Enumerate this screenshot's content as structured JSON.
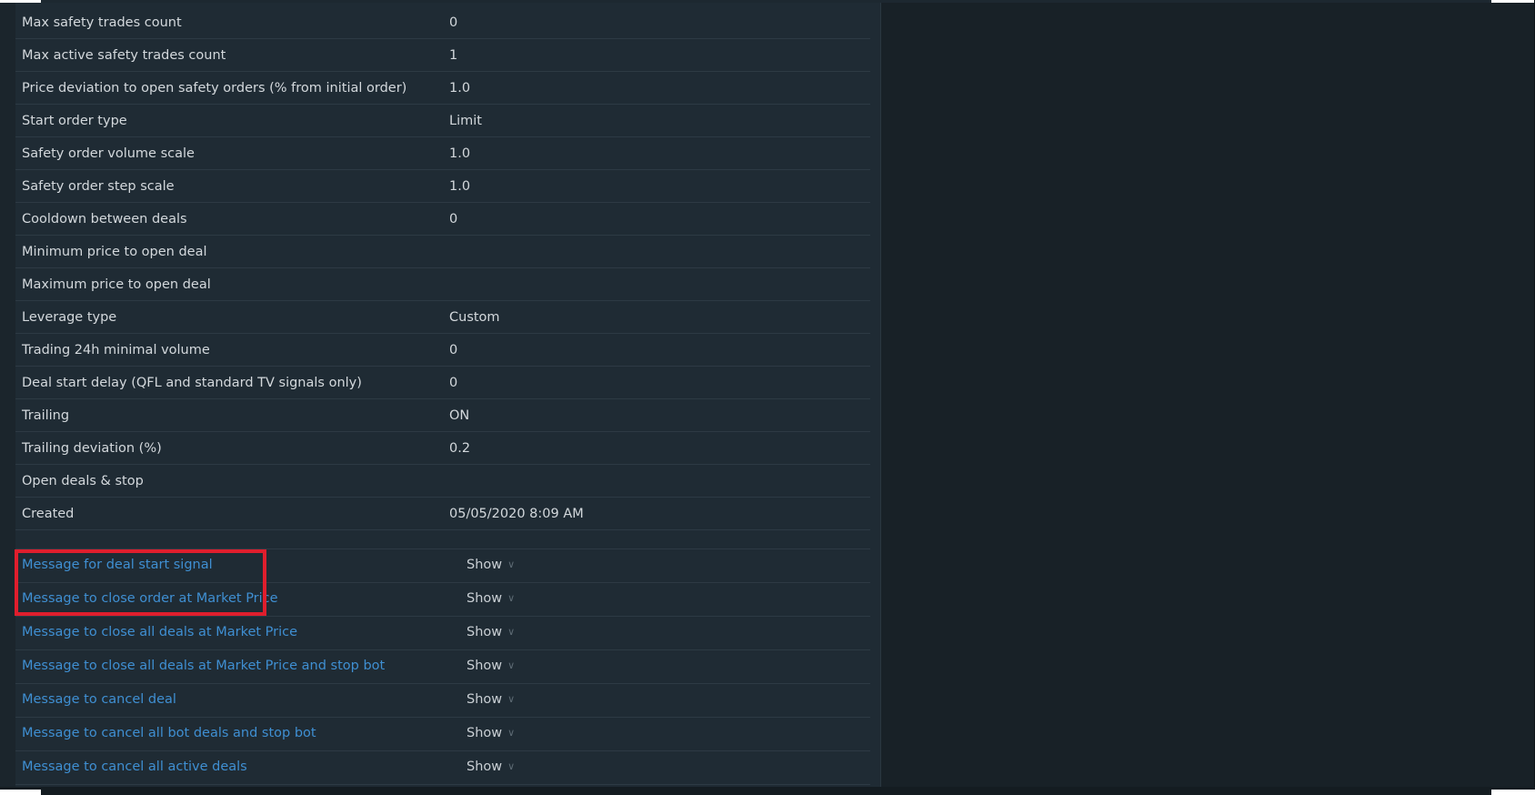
{
  "settings_rows": [
    {
      "label": "Max safety trades count",
      "value": "0"
    },
    {
      "label": "Max active safety trades count",
      "value": "1"
    },
    {
      "label": "Price deviation to open safety orders (% from initial order)",
      "value": "1.0"
    },
    {
      "label": "Start order type",
      "value": "Limit"
    },
    {
      "label": "Safety order volume scale",
      "value": "1.0"
    },
    {
      "label": "Safety order step scale",
      "value": "1.0"
    },
    {
      "label": "Cooldown between deals",
      "value": "0"
    },
    {
      "label": "Minimum price to open deal",
      "value": ""
    },
    {
      "label": "Maximum price to open deal",
      "value": ""
    },
    {
      "label": "Leverage type",
      "value": "Custom"
    },
    {
      "label": "Trading 24h minimal volume",
      "value": "0"
    },
    {
      "label": "Deal start delay (QFL and standard TV signals only)",
      "value": "0"
    },
    {
      "label": "Trailing",
      "value": "ON"
    },
    {
      "label": "Trailing deviation (%)",
      "value": "0.2"
    },
    {
      "label": "Open deals & stop",
      "value": ""
    },
    {
      "label": "Created",
      "value": "05/05/2020 8:09 AM"
    }
  ],
  "message_rows": [
    {
      "label": "Message for deal start signal",
      "toggle": "Show"
    },
    {
      "label": "Message to close order at Market Price",
      "toggle": "Show"
    },
    {
      "label": "Message to close all deals at Market Price",
      "toggle": "Show"
    },
    {
      "label": "Message to close all deals at Market Price and stop bot",
      "toggle": "Show"
    },
    {
      "label": "Message to cancel deal",
      "toggle": "Show"
    },
    {
      "label": "Message to cancel all bot deals and stop bot",
      "toggle": "Show"
    },
    {
      "label": "Message to cancel all active deals",
      "toggle": "Show"
    }
  ],
  "colors": {
    "link": "#3f8fd2",
    "highlight": "#e01e2d",
    "panel_bg": "#1f2b34",
    "page_bg": "#182127"
  }
}
